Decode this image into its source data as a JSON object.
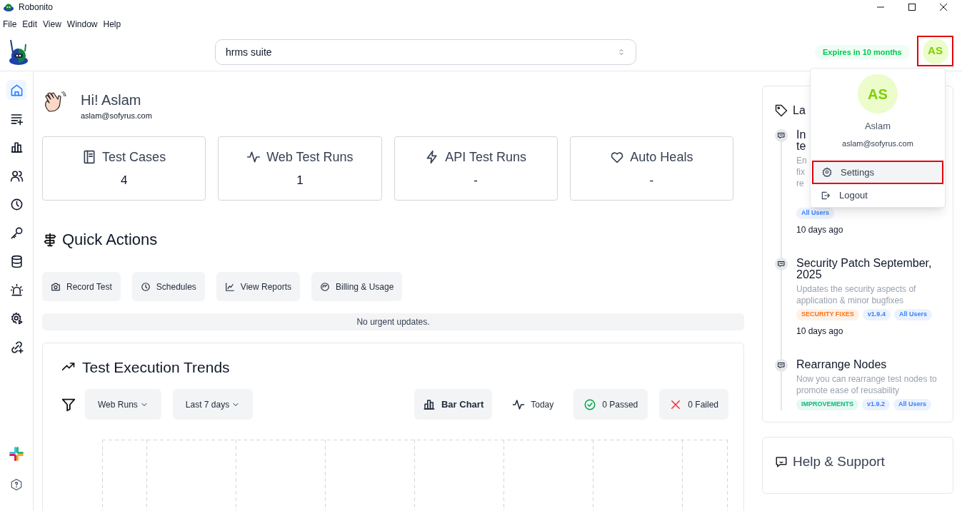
{
  "window": {
    "title": "Robonito"
  },
  "menu": [
    "File",
    "Edit",
    "View",
    "Window",
    "Help"
  ],
  "suite_select": {
    "value": "hrms suite"
  },
  "license_badge": "Expires in 10 months",
  "avatar": {
    "initials": "AS",
    "highlighted": true
  },
  "sidebar": {
    "items": [
      {
        "kind": "home",
        "selected": true
      },
      {
        "kind": "list-plus",
        "selected": false
      },
      {
        "kind": "bar-chart",
        "selected": false
      },
      {
        "kind": "users",
        "selected": false
      },
      {
        "kind": "clock",
        "selected": false
      },
      {
        "kind": "key",
        "selected": false
      },
      {
        "kind": "database",
        "selected": false
      },
      {
        "kind": "siren",
        "selected": false
      },
      {
        "kind": "cog-play",
        "selected": false
      },
      {
        "kind": "link-plus",
        "selected": false
      }
    ],
    "bottom": [
      {
        "kind": "slack"
      },
      {
        "kind": "help"
      }
    ]
  },
  "greeting": {
    "title": "Hi! Aslam",
    "email": "aslam@sofyrus.com"
  },
  "stats": [
    {
      "kind": "notebook",
      "label": "Test Cases",
      "value": "4"
    },
    {
      "kind": "pulse",
      "label": "Web Test Runs",
      "value": "1"
    },
    {
      "kind": "zap",
      "label": "API Test Runs",
      "value": "-"
    },
    {
      "kind": "heart",
      "label": "Auto Heals",
      "value": "-"
    }
  ],
  "quick_actions": {
    "title": "Quick Actions",
    "buttons": [
      {
        "kind": "camera",
        "label": "Record Test"
      },
      {
        "kind": "clock",
        "label": "Schedules"
      },
      {
        "kind": "chart-line",
        "label": "View Reports"
      },
      {
        "kind": "gauge",
        "label": "Billing & Usage"
      }
    ]
  },
  "notice": "No urgent updates.",
  "trends": {
    "title": "Test Execution Trends",
    "filters": [
      "Web Runs",
      "Last 7 days"
    ],
    "chart_type": "Bar Chart",
    "today": "Today",
    "passed": "0 Passed",
    "failed": "0 Failed"
  },
  "updates": {
    "title": "La",
    "items": [
      {
        "title": "In\nte",
        "description": "En\nfix\nre",
        "tags": [
          {
            "label": "All Users",
            "color": "#3b82f6"
          }
        ],
        "time": "10 days ago"
      },
      {
        "title": "Security Patch September, 2025",
        "description": "Updates the security aspects of application & minor bugfixes",
        "tags": [
          {
            "label": "SECURITY FIXES",
            "color": "#f97316"
          },
          {
            "label": "v1.9.4",
            "color": "#3b82f6"
          },
          {
            "label": "All Users",
            "color": "#3b82f6"
          }
        ],
        "time": "10 days ago"
      },
      {
        "title": "Rearrange Nodes",
        "description": "Now you can rearrange test nodes to promote ease of reusability",
        "tags": [
          {
            "label": "IMPROVEMENTS",
            "color": "#10b981"
          },
          {
            "label": "v1.9.2",
            "color": "#3b82f6"
          },
          {
            "label": "All Users",
            "color": "#3b82f6"
          }
        ]
      }
    ]
  },
  "help": {
    "title": "Help & Support"
  },
  "user_menu": {
    "initials": "AS",
    "name": "Aslam",
    "email": "aslam@sofyrus.com",
    "items": [
      {
        "kind": "settings",
        "label": "Settings",
        "highlighted": true
      },
      {
        "kind": "logout",
        "label": "Logout",
        "highlighted": false
      }
    ]
  }
}
